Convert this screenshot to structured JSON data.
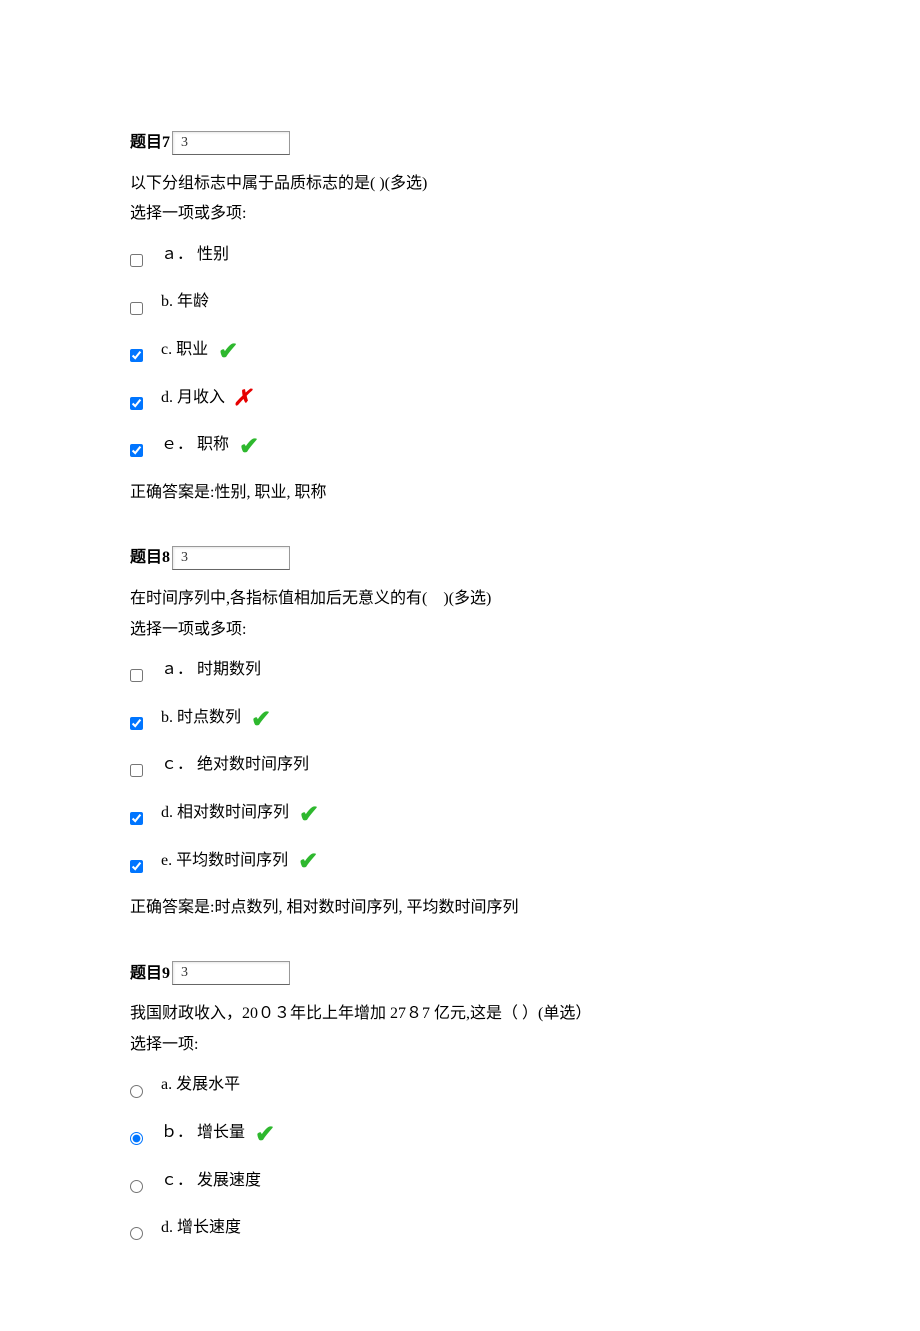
{
  "questions": [
    {
      "label": "题目7",
      "score": "3",
      "text": "以下分组标志中属于品质标志的是( )(多选)",
      "instruction": "选择一项或多项:",
      "type": "checkbox",
      "options": [
        {
          "prefix": "ａ．",
          "text": "性别",
          "checked": false,
          "mark": ""
        },
        {
          "prefix": "b.",
          "text": "年龄",
          "checked": false,
          "mark": ""
        },
        {
          "prefix": "c.",
          "text": "职业",
          "checked": true,
          "mark": "correct"
        },
        {
          "prefix": "d.",
          "text": "月收入",
          "checked": true,
          "mark": "incorrect"
        },
        {
          "prefix": "ｅ．",
          "text": "职称",
          "checked": true,
          "mark": "correct"
        }
      ],
      "answer": "正确答案是:性别, 职业, 职称"
    },
    {
      "label": "题目8",
      "score": "3",
      "text": "在时间序列中,各指标值相加后无意义的有(　)(多选)",
      "instruction": "选择一项或多项:",
      "type": "checkbox",
      "options": [
        {
          "prefix": "ａ．",
          "text": "时期数列",
          "checked": false,
          "mark": ""
        },
        {
          "prefix": "b.",
          "text": "  时点数列",
          "checked": true,
          "mark": "correct"
        },
        {
          "prefix": "ｃ．",
          "text": "  绝对数时间序列",
          "checked": false,
          "mark": ""
        },
        {
          "prefix": "d.",
          "text": "相对数时间序列",
          "checked": true,
          "mark": "correct"
        },
        {
          "prefix": "e.",
          "text": "   平均数时间序列",
          "checked": true,
          "mark": "correct"
        }
      ],
      "answer": "正确答案是:时点数列, 相对数时间序列, 平均数时间序列"
    },
    {
      "label": "题目9",
      "score": "3",
      "text": "我国财政收入，20０３年比上年增加 27８7 亿元,这是（ ）(单选）",
      "instruction": "选择一项:",
      "type": "radio",
      "options": [
        {
          "prefix": "a.",
          "text": "  发展水平",
          "checked": false,
          "mark": ""
        },
        {
          "prefix": "ｂ．",
          "text": "增长量",
          "checked": true,
          "mark": "correct"
        },
        {
          "prefix": "ｃ．",
          "text": "  发展速度",
          "checked": false,
          "mark": ""
        },
        {
          "prefix": "d.",
          "text": "增长速度",
          "checked": false,
          "mark": ""
        }
      ],
      "answer": ""
    }
  ]
}
